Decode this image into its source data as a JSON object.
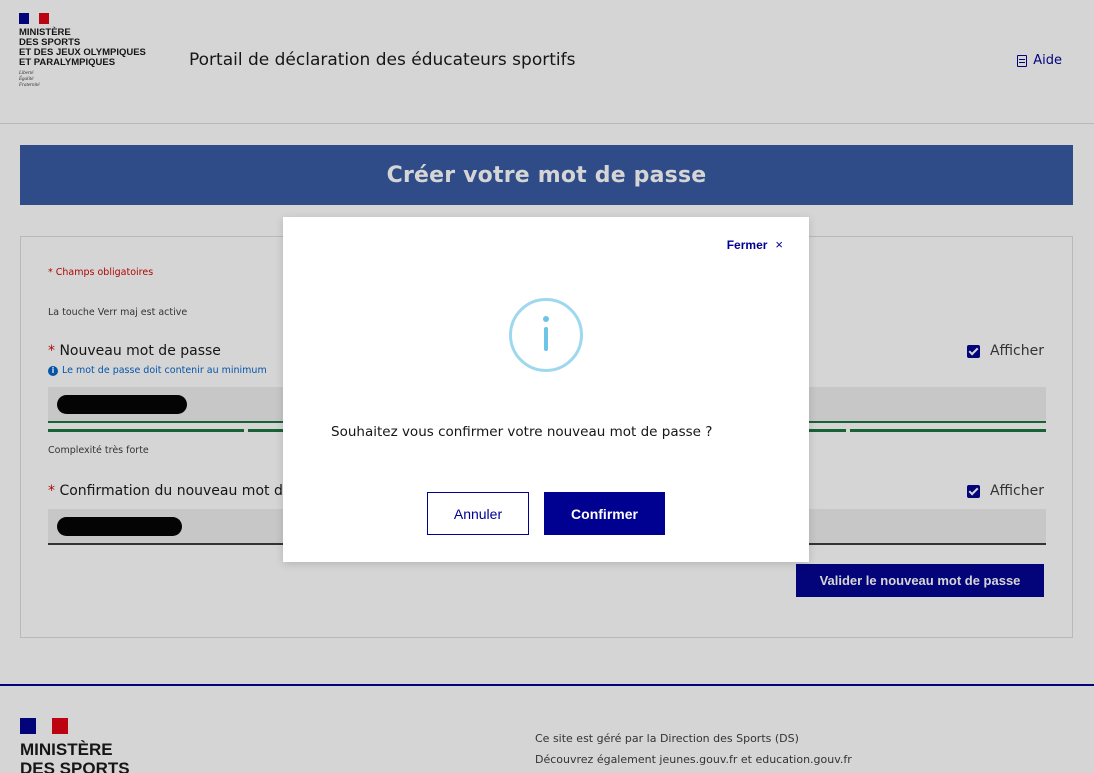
{
  "header": {
    "ministry_lines": [
      "Ministère",
      "des sports",
      "et des jeux olympiques",
      "et paralympiques"
    ],
    "devise_lines": [
      "Liberté",
      "Égalité",
      "Fraternité"
    ],
    "site_title": "Portail de déclaration des éducateurs sportifs",
    "help_label": "Aide"
  },
  "banner": {
    "title": "Créer votre mot de passe"
  },
  "form": {
    "required_note": "* Champs obligatoires",
    "capslock_note": "La touche Verr maj est active",
    "required_star": "*",
    "new_password_label": "Nouveau mot de passe",
    "new_password_hint": "Le mot de passe doit contenir au minimum",
    "show_label": "Afficher",
    "strength_label": "Complexité très forte",
    "confirm_password_label": "Confirmation du nouveau mot de",
    "submit_label": "Valider le nouveau mot de passe",
    "strength_segments": 5
  },
  "footer": {
    "ministry_lines": [
      "Ministère",
      "des sports"
    ],
    "line1": "Ce site est géré par la Direction des Sports (DS)",
    "line2": "Découvrez également jeunes.gouv.fr et education.gouv.fr"
  },
  "modal": {
    "close_label": "Fermer",
    "close_glyph": "×",
    "icon": "info-icon",
    "message": "Souhaitez vous confirmer votre nouveau mot de passe ?",
    "cancel_label": "Annuler",
    "confirm_label": "Confirmer"
  },
  "colors": {
    "brand_blue": "#000091",
    "banner_blue": "#3558a2",
    "success_green": "#18753c",
    "error_red": "#ce0500",
    "info_light_blue": "#6cc4e6"
  }
}
